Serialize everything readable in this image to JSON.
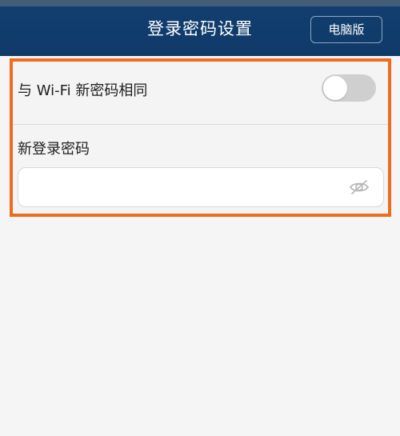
{
  "header": {
    "title": "登录密码设置",
    "pc_button_label": "电脑版"
  },
  "settings": {
    "sync_with_wifi_label": "与 Wi-Fi 新密码相同",
    "sync_with_wifi_enabled": false,
    "new_password_label": "新登录密码",
    "new_password_value": ""
  },
  "icons": {
    "visibility_toggle": "eye-slash-icon"
  },
  "colors": {
    "header": "#123f70",
    "highlight": "#ef6b1d",
    "toggle_off": "#cfcfcf"
  }
}
